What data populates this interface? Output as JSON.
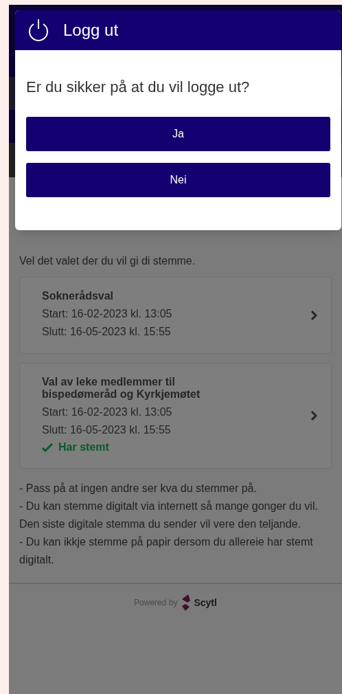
{
  "dialog": {
    "title": "Logg ut",
    "message": "Er du sikker på at du vil logge ut?",
    "buttons": [
      "Ja",
      "Nei"
    ]
  },
  "page": {
    "intro": "Vel det valet der du vil gi di stemme.",
    "elections": [
      {
        "title": "Soknerådsval",
        "start": "Start: 16-02-2023 kl. 13:05",
        "end": "Slutt: 16-05-2023 kl. 15:55"
      },
      {
        "title": "Val av leke medlemmer til bispedømeråd og Kyrkjemøtet",
        "start": "Start: 16-02-2023 kl. 13:05",
        "end": "Slutt: 16-05-2023 kl. 15:55",
        "status": "Har stemt"
      }
    ],
    "notes": [
      "- Pass på at ingen andre ser kva du stemmer på.",
      "- Du kan stemme digitalt via internett så mange gonger du vil. Den siste digitale stemma du sender vil vere den teljande.",
      "- Du kan ikkje stemme på papir dersom du allereie har stemt digitalt."
    ],
    "footer": {
      "powered_by": "Powered by",
      "brand": "Scytl"
    }
  }
}
